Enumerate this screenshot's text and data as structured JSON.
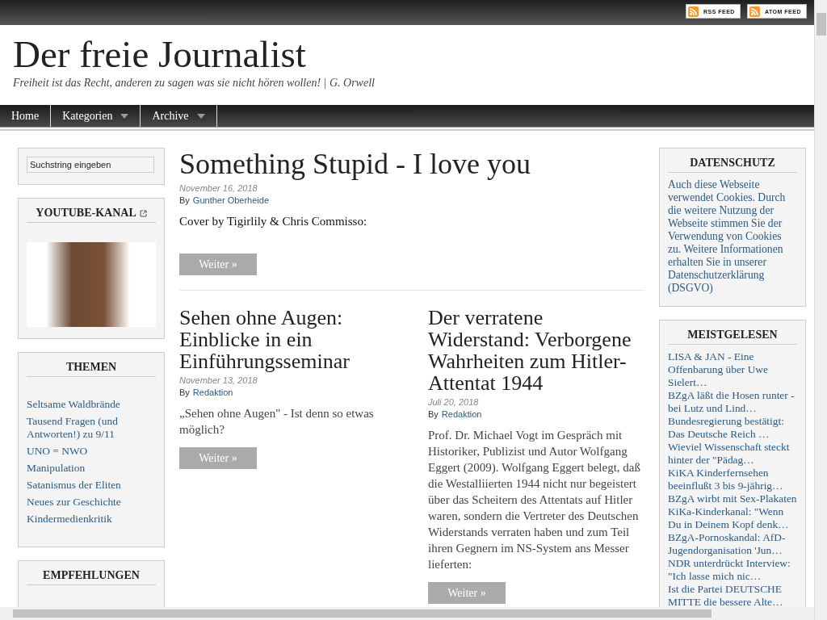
{
  "top_bar": {
    "feeds": [
      {
        "label": "RSS FEED"
      },
      {
        "label": "ATOM FEED"
      }
    ]
  },
  "header": {
    "title": "Der freie Journalist",
    "tagline": "Freiheit ist das Recht, anderen zu sagen was sie nicht hören wollen! | G. Orwell"
  },
  "nav": [
    {
      "label": "Home",
      "has_menu": false
    },
    {
      "label": "Kategorien",
      "has_menu": true
    },
    {
      "label": "Archive",
      "has_menu": true
    }
  ],
  "left_sidebar": {
    "search": {
      "placeholder": "Suchstring eingeben"
    },
    "widgets": [
      {
        "kind": "image",
        "title": "YOUTUBE-KANAL",
        "external": true
      },
      {
        "kind": "links",
        "title": "THEMEN",
        "external": false,
        "items": [
          "Seltsame Waldbrände",
          "Tausend Fragen (und Antworten!) zu 9/11",
          "UNO = NWO",
          "Manipulation",
          "Satanismus der Eliten",
          "Neues zur Geschichte",
          "Kindermedienkritik"
        ]
      },
      {
        "kind": "empty",
        "title": "EMPFEHLUNGEN",
        "external": false
      }
    ]
  },
  "featured_post": {
    "title": "Something Stupid - I love you",
    "date": "November 16, 2018",
    "by": "By",
    "author": "Gunther Oberheide",
    "excerpt": "Cover by Tigirlily & Chris Commisso:",
    "button": "Weiter »"
  },
  "post_columns": [
    {
      "title": "Sehen ohne Augen: Einblicke in ein Einführungsseminar",
      "date": "November 13, 2018",
      "by": "By",
      "author": "Redaktion",
      "excerpt": "„Sehen ohne Augen\" - Ist denn so etwas möglich?",
      "button": "Weiter »"
    },
    {
      "title": "Der verratene Widerstand: Verborgene Wahrheiten zum Hitler-Attentat 1944",
      "date": "Juli 20, 2018",
      "by": "By",
      "author": "Redaktion",
      "excerpt": "Prof. Dr. Michael Vogt im Gespräch mit Historiker, Publizist und Autor Wolfgang Eggert (2009). Wolfgang Eggert belegt, daß die Westalliierten 1944 nicht nur begeistert über das Scheitern des Attentats auf Hitler waren, sondern die Vertreter des Deutschen Widerstands verraten haben und zum Teil ihren Gegnern im NS-System ans Messer lieferten:",
      "button": "Weiter »"
    }
  ],
  "right_sidebar": {
    "widgets": [
      {
        "kind": "text",
        "title": "DATENSCHUTZ",
        "text": "Auch diese Webseite verwendet Cookies. Durch die weitere Nutzung der Webseite stimmen Sie der Verwendung von Cookies zu. Weitere Informationen erhalten Sie in unserer Datenschutzerklärung (DSGVO)"
      },
      {
        "kind": "links",
        "title": "MEISTGELESEN",
        "items": [
          "LISA & JAN - Eine Offenbarung über Uwe Sielert…",
          "BZgA läßt die Hosen runter - bei Lutz und Lind…",
          "Bundesregierung bestätigt: Das Deutsche Reich …",
          "Wieviel Wissenschaft steckt hinter der \"Pädag…",
          "KiKA Kinderfernsehen beeinflußt 3 bis 9-jährig…",
          "BZgA wirbt mit Sex-Plakaten",
          "KiKa-Kinderkanal: \"Wenn Du in Deinem Kopf denk…",
          "BZgA-Pornoskandal: AfD-Jugendorganisation 'Jun…",
          "NDR unterdrückt Interview: \"Ich lasse mich nic…",
          "Ist die Partei DEUTSCHE MITTE die bessere Alte…"
        ]
      }
    ]
  }
}
